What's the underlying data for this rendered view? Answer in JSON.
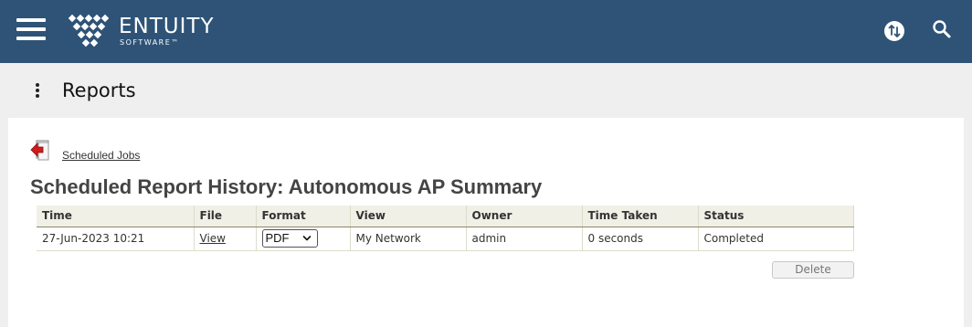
{
  "header": {
    "logo_name": "ENTUITY",
    "logo_sub": "SOFTWARE™",
    "menu_icon": "hamburger-menu-icon",
    "sync_icon": "sync-icon",
    "search_icon": "search-icon",
    "bar_color": "#2e5377"
  },
  "subheader": {
    "title": "Reports",
    "more_icon": "more-vertical-icon"
  },
  "back": {
    "icon": "back-arrow-icon",
    "label": "Scheduled Jobs"
  },
  "history": {
    "title": "Scheduled Report History: Autonomous AP Summary",
    "columns": [
      "Time",
      "File",
      "Format",
      "View",
      "Owner",
      "Time Taken",
      "Status"
    ],
    "rows": [
      {
        "time": "27-Jun-2023 10:21",
        "file": "View",
        "format": "PDF",
        "view": "My Network",
        "owner": "admin",
        "time_taken": "0 seconds",
        "status": "Completed"
      }
    ]
  },
  "actions": {
    "delete_label": "Delete"
  }
}
